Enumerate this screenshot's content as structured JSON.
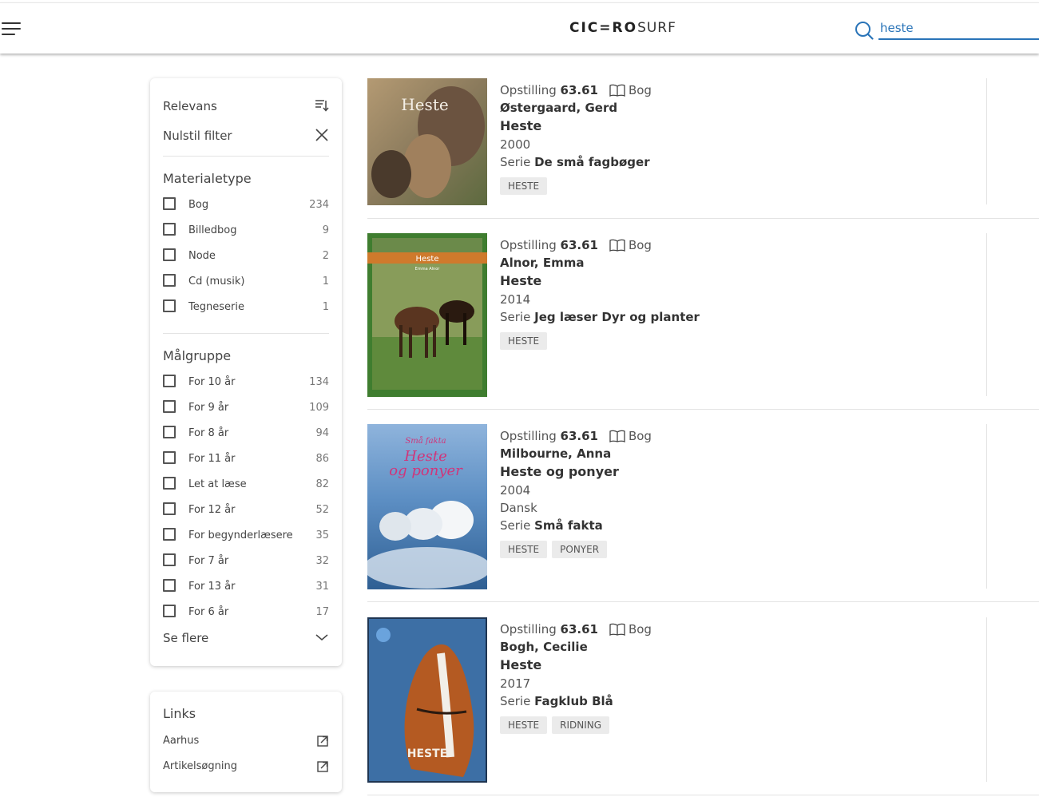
{
  "header": {
    "logo_bold": "CIC=RO",
    "logo_light": "SURF",
    "search_value": "heste"
  },
  "filters": {
    "sort_label": "Relevans",
    "reset_label": "Nulstil filter",
    "material_title": "Materialetype",
    "material_items": [
      {
        "label": "Bog",
        "count": "234"
      },
      {
        "label": "Billedbog",
        "count": "9"
      },
      {
        "label": "Node",
        "count": "2"
      },
      {
        "label": "Cd (musik)",
        "count": "1"
      },
      {
        "label": "Tegneserie",
        "count": "1"
      }
    ],
    "audience_title": "Målgruppe",
    "audience_items": [
      {
        "label": "For 10 år",
        "count": "134"
      },
      {
        "label": "For 9 år",
        "count": "109"
      },
      {
        "label": "For 8 år",
        "count": "94"
      },
      {
        "label": "For 11 år",
        "count": "86"
      },
      {
        "label": "Let at læse",
        "count": "82"
      },
      {
        "label": "For 12 år",
        "count": "52"
      },
      {
        "label": "For begynderlæsere",
        "count": "35"
      },
      {
        "label": "For 7 år",
        "count": "32"
      },
      {
        "label": "For 13 år",
        "count": "31"
      },
      {
        "label": "For 6 år",
        "count": "17"
      }
    ],
    "see_more_label": "Se flere"
  },
  "links": {
    "title": "Links",
    "items": [
      {
        "label": "Aarhus"
      },
      {
        "label": "Artikelsøgning"
      }
    ]
  },
  "results": [
    {
      "shelf_prefix": "Opstilling",
      "shelf": "63.61",
      "type": "Bog",
      "author": "Østergaard, Gerd",
      "title": "Heste",
      "year": "2000",
      "language": "",
      "series_prefix": "Serie",
      "series": "De små fagbøger",
      "tags": [
        "HESTE"
      ],
      "cover_text": "Heste",
      "cover_color": "#8a7a5c"
    },
    {
      "shelf_prefix": "Opstilling",
      "shelf": "63.61",
      "type": "Bog",
      "author": "Alnor, Emma",
      "title": "Heste",
      "year": "2014",
      "language": "",
      "series_prefix": "Serie",
      "series": "Jeg læser Dyr og planter",
      "tags": [
        "HESTE"
      ],
      "cover_text": "Heste",
      "cover_sub": "Emma Alnor",
      "cover_color": "#3f7d2f"
    },
    {
      "shelf_prefix": "Opstilling",
      "shelf": "63.61",
      "type": "Bog",
      "author": "Milbourne, Anna",
      "title": "Heste og ponyer",
      "year": "2004",
      "language": "Dansk",
      "series_prefix": "Serie",
      "series": "Små fakta",
      "tags": [
        "HESTE",
        "PONYER"
      ],
      "cover_pre": "Små fakta",
      "cover_text": "Heste",
      "cover_text2": "og ponyer",
      "cover_color": "#5d8fc4"
    },
    {
      "shelf_prefix": "Opstilling",
      "shelf": "63.61",
      "type": "Bog",
      "author": "Bogh, Cecilie",
      "title": "Heste",
      "year": "2017",
      "language": "",
      "series_prefix": "Serie",
      "series": "Fagklub Blå",
      "tags": [
        "HESTE",
        "RIDNING"
      ],
      "cover_text": "HESTE",
      "cover_color": "#3d6fa5"
    }
  ],
  "colors": {
    "accent": "#2a74b8",
    "tag_bg": "#ebebeb"
  }
}
